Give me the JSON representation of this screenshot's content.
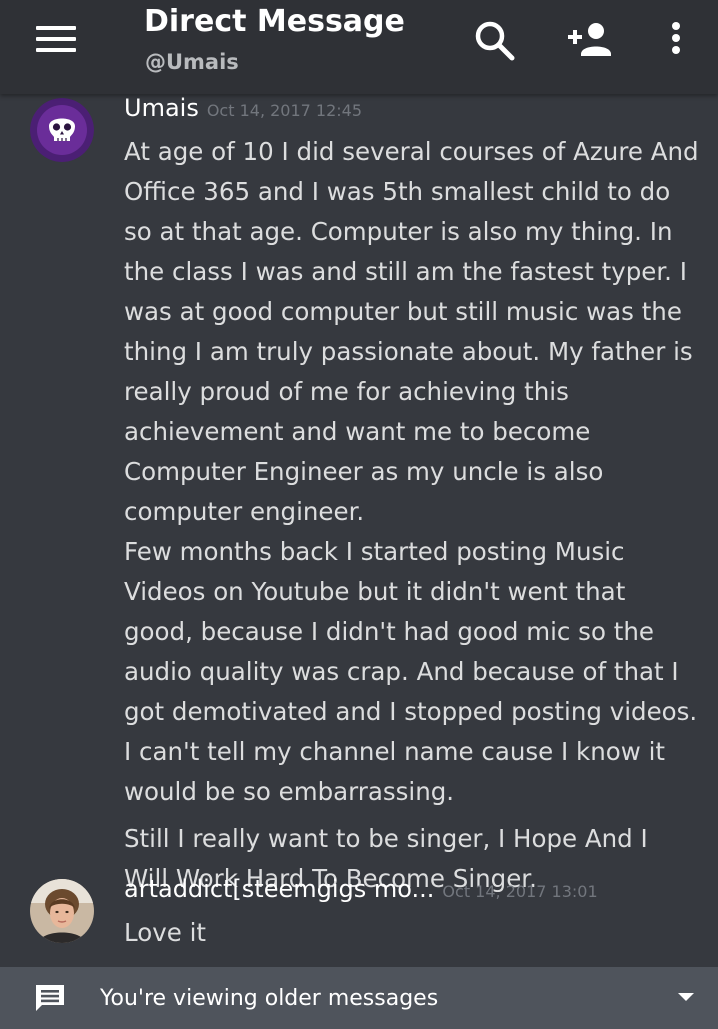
{
  "header": {
    "title": "Direct Message",
    "subtitle": "@Umais",
    "icons": [
      "menu-icon",
      "search-icon",
      "add-friend-icon",
      "more-vertical-icon"
    ]
  },
  "messages": [
    {
      "username": "Umais",
      "timestamp": "Oct 14, 2017 12:45",
      "avatar": "skull-avatar",
      "paragraphs": [
        "At age of 10 I did several courses of Azure And Office 365 and I was 5th smallest child to do so at that age. Computer is also my thing. In the class I was and still am the fastest typer. I was at good computer but still music was the thing I am truly passionate about. My father is really proud of me for achieving this achievement and want me to become Computer Engineer as my uncle is also computer engineer.",
        "Few months back I started posting Music Videos on Youtube but it didn't went that good, because I didn't had good mic so the audio quality was crap. And because of that I got demotivated and I stopped posting videos. I can't tell my channel name cause I know it would be so embarrassing.",
        "Still I really want to be singer, I Hope And I Will Work Hard To Become Singer."
      ]
    },
    {
      "username": "artaddict[steemgigs mo...",
      "timestamp": "Oct 14, 2017 13:01",
      "avatar": "photo-avatar",
      "paragraphs": [
        "Love it"
      ]
    }
  ],
  "footer": {
    "text": "You're viewing older messages",
    "icon": "message-icon"
  },
  "colors": {
    "background": "#36393f",
    "header": "#2f3136",
    "footer": "#4f545c",
    "avatar_purple": "#6a2d99"
  }
}
